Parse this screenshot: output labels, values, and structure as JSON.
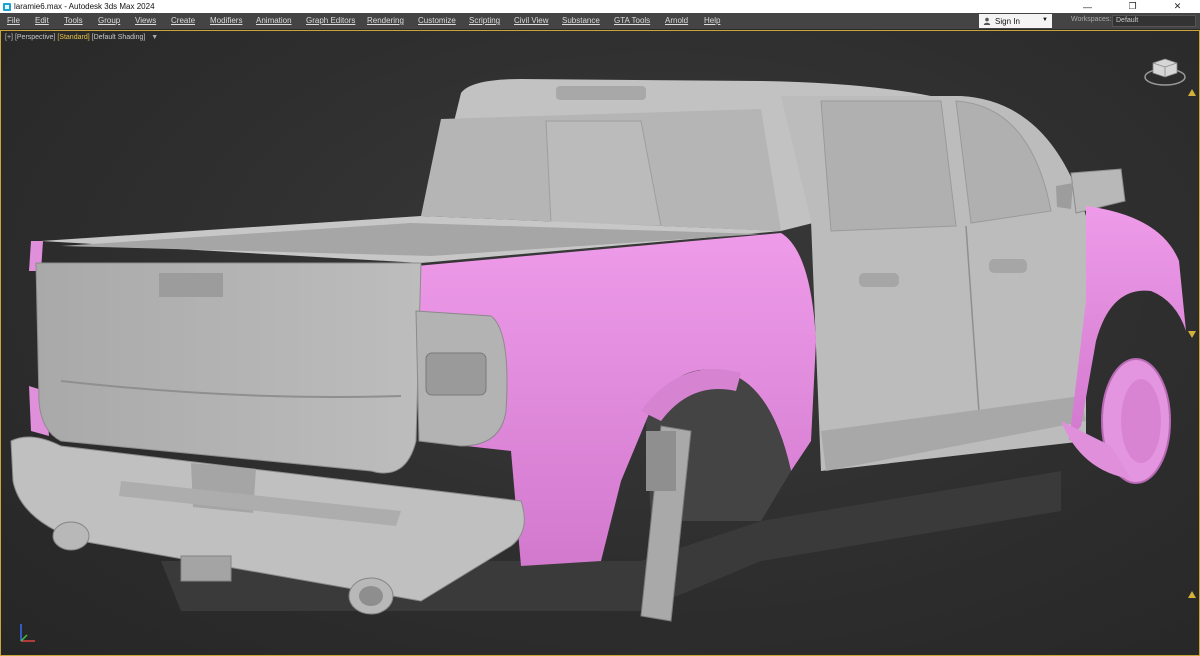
{
  "window": {
    "title": "laramie6.max - Autodesk 3ds Max 2024",
    "controls": [
      "—",
      "❐",
      "✕"
    ]
  },
  "menubar": {
    "items": [
      {
        "label": "File"
      },
      {
        "label": "Edit"
      },
      {
        "label": "Tools"
      },
      {
        "label": "Group"
      },
      {
        "label": "Views"
      },
      {
        "label": "Create"
      },
      {
        "label": "Modifiers"
      },
      {
        "label": "Animation"
      },
      {
        "label": "Graph Editors"
      },
      {
        "label": "Rendering"
      },
      {
        "label": "Customize"
      },
      {
        "label": "Scripting"
      },
      {
        "label": "Civil View"
      },
      {
        "label": "Substance"
      },
      {
        "label": "GTA Tools"
      },
      {
        "label": "Arnold"
      },
      {
        "label": "Help"
      }
    ],
    "sign_in": "Sign In",
    "workspaces_label": "Workspaces:",
    "workspace_value": "Default"
  },
  "viewport": {
    "label_plus": "[+]",
    "label_view": "[Perspective]",
    "label_shading_preset": "[Standard]",
    "label_shading": "[Default Shading]",
    "colors": {
      "body": "#b9b9b9",
      "body_dark": "#8e8e8e",
      "selected": "#e58fe0",
      "selected_dark": "#b965b6",
      "border": "#c9a53a"
    }
  },
  "icons": {
    "app": "3dsmax-app-icon",
    "user": "user-icon",
    "filter": "filter-icon",
    "viewcube": "viewcube-icon",
    "axis": "axis-tripod-icon"
  }
}
